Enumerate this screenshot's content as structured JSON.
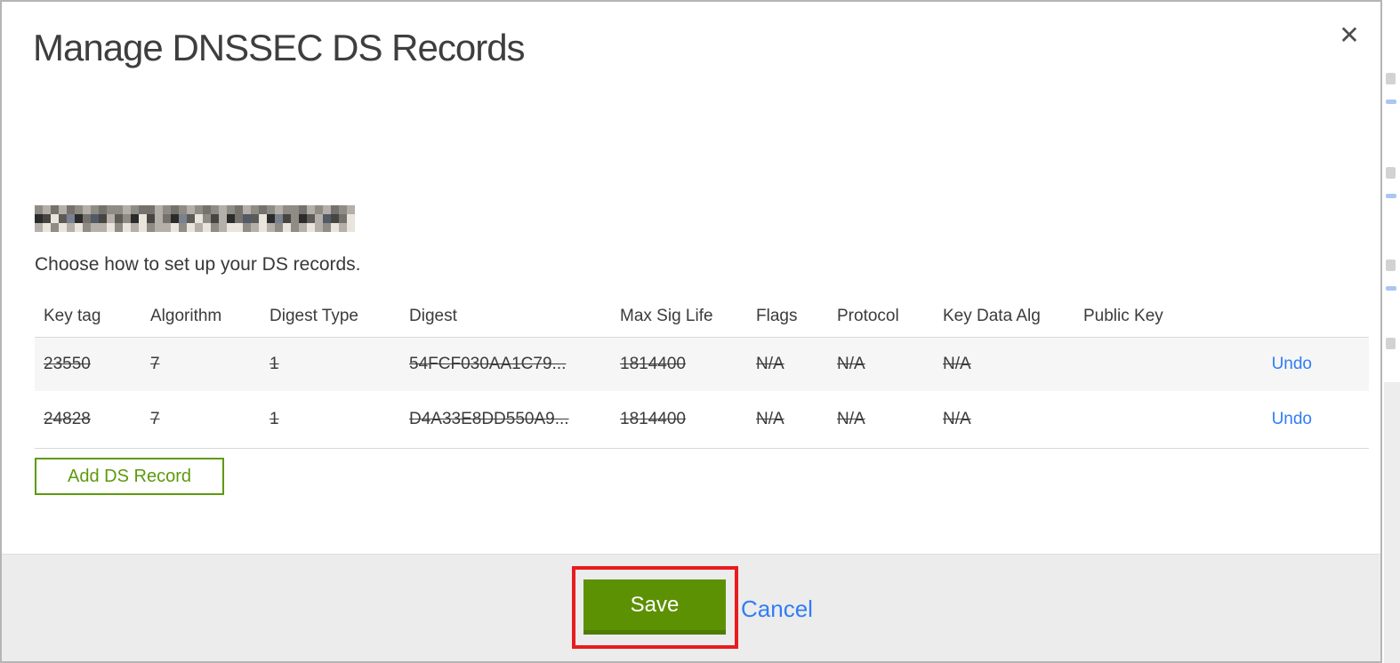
{
  "modal": {
    "title": "Manage DNSSEC DS Records",
    "close_icon": "✕",
    "subtitle": "Choose how to set up your DS records.",
    "domain_redacted": true
  },
  "table": {
    "headers": [
      "Key tag",
      "Algorithm",
      "Digest Type",
      "Digest",
      "Max Sig Life",
      "Flags",
      "Protocol",
      "Key Data Alg",
      "Public Key"
    ],
    "rows": [
      {
        "key_tag": "23550",
        "algorithm": "7",
        "digest_type": "1",
        "digest": "54FCF030AA1C79...",
        "max_sig_life": "1814400",
        "flags": "N/A",
        "protocol": "N/A",
        "key_data_alg": "N/A",
        "public_key": "",
        "action": "Undo",
        "state": "deleted"
      },
      {
        "key_tag": "24828",
        "algorithm": "7",
        "digest_type": "1",
        "digest": "D4A33E8DD550A9...",
        "max_sig_life": "1814400",
        "flags": "N/A",
        "protocol": "N/A",
        "key_data_alg": "N/A",
        "public_key": "",
        "action": "Undo",
        "state": "deleted"
      }
    ]
  },
  "buttons": {
    "add_ds_record": "Add DS Record",
    "save": "Save",
    "cancel": "Cancel"
  },
  "annotation": {
    "highlight_color": "#e81c1f",
    "highlighted_element": "save-button"
  },
  "colors": {
    "accent_green": "#5d9104",
    "green_dark": "#4c7c04",
    "outline_green": "#5d9a0c",
    "link_blue": "#307df5",
    "footer_gray": "#ececec",
    "row_alt_gray": "#f6f6f7",
    "border_gray": "#b5b5b5"
  },
  "redacted": {
    "palette": [
      "#2b2b2b",
      "#474542",
      "#5d5b58",
      "#75716c",
      "#8f8b85",
      "#b4b0a9",
      "#e9e5dd",
      "#79828e",
      "#515a66"
    ],
    "rows": [
      "4535345434454335434543454354345443545345",
      "0162703815240615307264150382607140258136",
      "5646564556465645564656456645654645654656"
    ]
  }
}
